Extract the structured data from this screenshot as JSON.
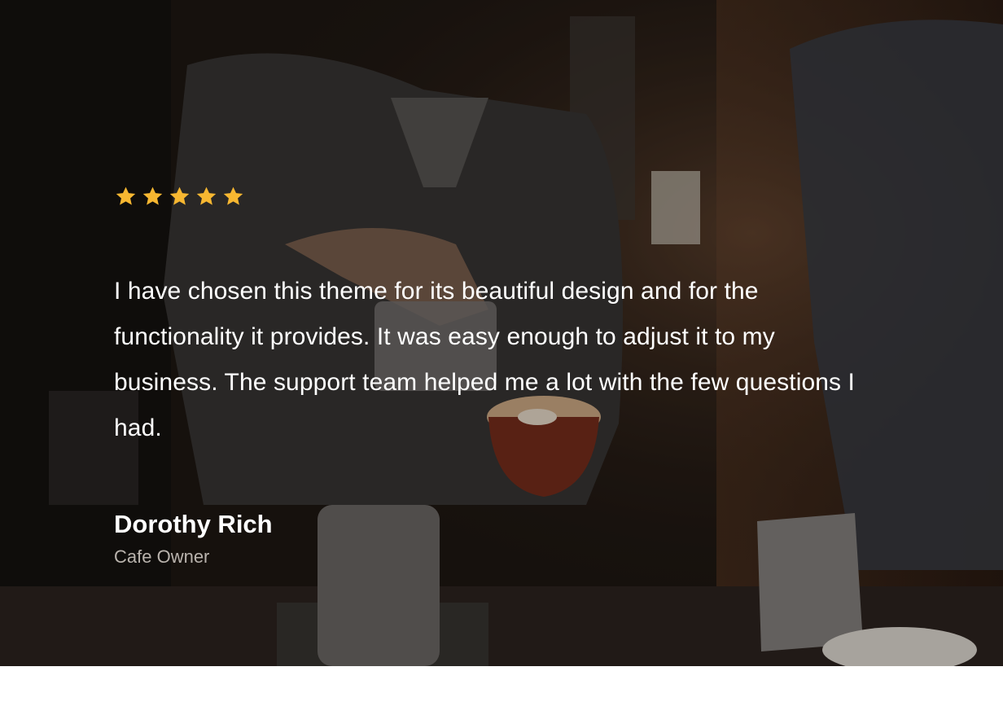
{
  "testimonial": {
    "rating": 5,
    "rating_color": "#f7b731",
    "quote": "I have chosen this theme for its beautiful design and for the functionality it provides. It was easy enough to adjust it to my business. The support team helped me a lot with the few questions I had.",
    "author_name": "Dorothy Rich",
    "author_role": "Cafe Owner"
  }
}
